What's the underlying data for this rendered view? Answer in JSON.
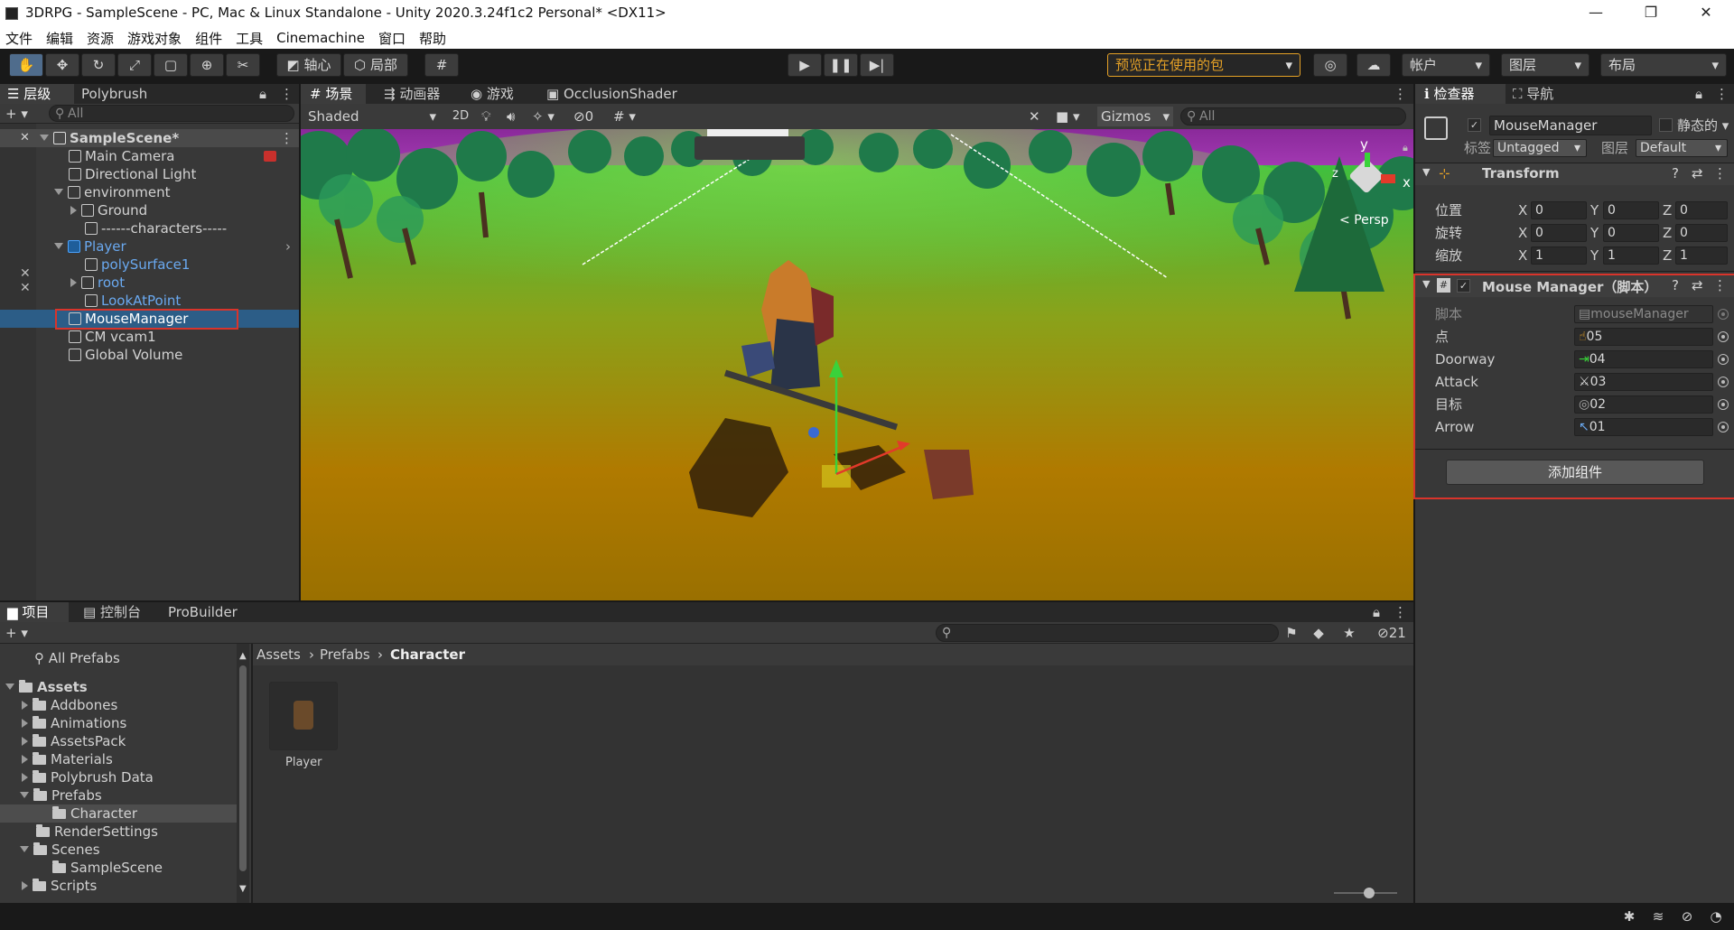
{
  "window": {
    "title": "3DRPG - SampleScene - PC, Mac & Linux Standalone - Unity 2020.3.24f1c2 Personal* <DX11>",
    "minimize": "—",
    "maximize": "❐",
    "close": "✕"
  },
  "menu": [
    "文件",
    "编辑",
    "资源",
    "游戏对象",
    "组件",
    "工具",
    "Cinemachine",
    "窗口",
    "帮助"
  ],
  "toolbar": {
    "pivot": "轴心",
    "local": "局部",
    "packages": "预览正在使用的包",
    "account": "帐户",
    "layers": "图层",
    "layout": "布局"
  },
  "hierarchy": {
    "tabs": [
      "层级",
      "Polybrush"
    ],
    "search": "All",
    "scene": "SampleScene*",
    "items": [
      {
        "label": "Main Camera"
      },
      {
        "label": "Directional Light"
      },
      {
        "label": "environment"
      },
      {
        "label": "Ground"
      },
      {
        "label": "------characters-----"
      },
      {
        "label": "Player"
      },
      {
        "label": "polySurface1"
      },
      {
        "label": "root"
      },
      {
        "label": "LookAtPoint"
      },
      {
        "label": "MouseManager"
      },
      {
        "label": "CM vcam1"
      },
      {
        "label": "Global Volume"
      }
    ]
  },
  "sceneview": {
    "tabs": [
      "场景",
      "动画器",
      "游戏",
      "OcclusionShader"
    ],
    "shading": "Shaded",
    "mode2d": "2D",
    "hidden_count": "0",
    "gizmos": "Gizmos",
    "search": "All",
    "persp": "Persp",
    "axis_y": "y",
    "axis_x": "x",
    "axis_z": "z"
  },
  "inspector": {
    "tabs": [
      "检查器",
      "导航"
    ],
    "object_name": "MouseManager",
    "static": "静态的",
    "tag_label": "标签",
    "tag": "Untagged",
    "layer_label": "图层",
    "layer": "Default",
    "transform": {
      "title": "Transform",
      "rows": [
        {
          "label": "位置",
          "x": "0",
          "y": "0",
          "z": "0"
        },
        {
          "label": "旋转",
          "x": "0",
          "y": "0",
          "z": "0"
        },
        {
          "label": "缩放",
          "x": "1",
          "y": "1",
          "z": "1"
        }
      ],
      "axis": [
        "X",
        "Y",
        "Z"
      ]
    },
    "script_comp": {
      "title": "Mouse Manager（脚本）",
      "fields": [
        {
          "label": "脚本",
          "value": "mouseManager"
        },
        {
          "label": "点",
          "value": "05"
        },
        {
          "label": "Doorway",
          "value": "04"
        },
        {
          "label": "Attack",
          "value": "03"
        },
        {
          "label": "目标",
          "value": "02"
        },
        {
          "label": "Arrow",
          "value": "01"
        }
      ]
    },
    "add_component": "添加组件"
  },
  "project": {
    "tabs": [
      "项目",
      "控制台",
      "ProBuilder"
    ],
    "all_prefabs": "All Prefabs",
    "hidden_count": "21",
    "breadcrumb": [
      "Assets",
      "Prefabs",
      "Character"
    ],
    "tree": [
      {
        "label": "Assets"
      },
      {
        "label": "Addbones"
      },
      {
        "label": "Animations"
      },
      {
        "label": "AssetsPack"
      },
      {
        "label": "Materials"
      },
      {
        "label": "Polybrush Data"
      },
      {
        "label": "Prefabs"
      },
      {
        "label": "Character"
      },
      {
        "label": "RenderSettings"
      },
      {
        "label": "Scenes"
      },
      {
        "label": "SampleScene"
      },
      {
        "label": "Scripts"
      }
    ],
    "asset": "Player"
  },
  "colors": {
    "selection": "#2c5d87",
    "highlight_box": "#d9342b",
    "accent_orange": "#e5a126",
    "blue_label": "#6aa9f0"
  }
}
